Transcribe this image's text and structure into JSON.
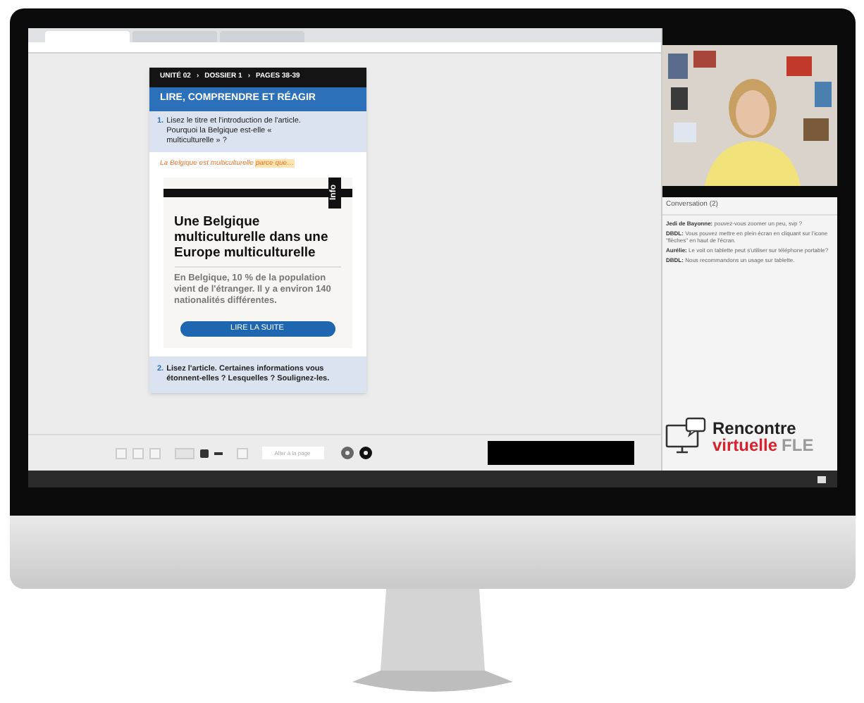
{
  "browser": {
    "tabs": [
      {
        "selected": true
      },
      {
        "selected": false
      },
      {
        "selected": false
      }
    ]
  },
  "lesson": {
    "breadcrumb": [
      "UNITÉ 02",
      "DOSSIER 1",
      "PAGES 38-39"
    ],
    "separator": "›",
    "section_title": "LIRE, COMPRENDRE ET RÉAGIR",
    "question_1": {
      "number": "1.",
      "text": "Lisez le titre et l'introduction de l'article. Pourquoi la Belgique est-elle « multiculturelle » ?"
    },
    "answer_start": "La Belgique est multiculturelle",
    "answer_highlight": "parce que…",
    "article": {
      "tag": "Info",
      "title": "Une Belgique multiculturelle dans une Europe multiculturelle",
      "lead": "En Belgique, 10 % de la population vient de l'étranger. Il y a environ 140 nationalités différentes.",
      "button": "LIRE LA SUITE"
    },
    "question_2": {
      "number": "2.",
      "text": "Lisez l'article. Certaines informations vous étonnent-elles ? Lesquelles ? Soulignez-les."
    }
  },
  "toolbar": {
    "page_field_placeholder": "Aller à la page"
  },
  "chat": {
    "title": "Conversation (2)",
    "messages": [
      {
        "author": "Jedi de Bayonne:",
        "text": "pouvez-vous zoomer un peu, svp ?"
      },
      {
        "author": "DBDL:",
        "text": "Vous pouvez mettre en plein écran en cliquant sur l'icone \"flèches\" en haut de l'écran."
      },
      {
        "author": "Aurélie:",
        "text": "Le voit on tablette peut s'utiliser sur téléphone portable?"
      },
      {
        "author": "DBDL:",
        "text": "Nous recommandons un usage sur tablette."
      }
    ]
  },
  "logo": {
    "line_1": "Rencontre",
    "line_2": "virtuelle",
    "line_3": "FLE"
  }
}
